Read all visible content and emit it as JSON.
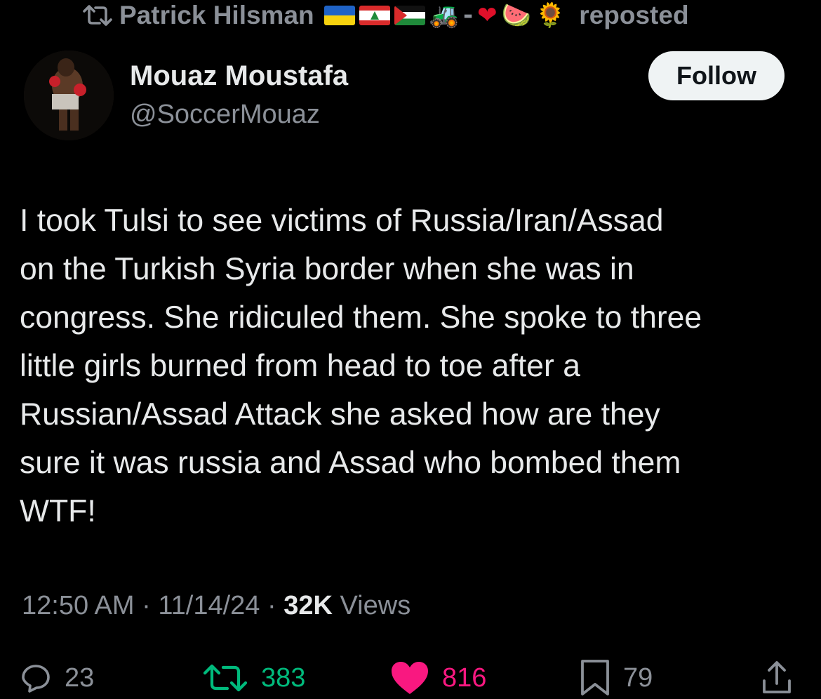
{
  "repost_header": {
    "reposter_name": "Patrick Hilsman",
    "emoji_flags": [
      "ukraine-flag",
      "lebanon-flag",
      "palestine-flag"
    ],
    "emoji_extra": {
      "tractor": "🚜",
      "dash": "-",
      "heart": "❤",
      "watermelon": "🍉",
      "sunflower": "🌻"
    },
    "label": "reposted"
  },
  "author": {
    "name": "Mouaz Moustafa",
    "handle": "@SoccerMouaz"
  },
  "follow_button": {
    "label": "Follow"
  },
  "tweet": {
    "lines": [
      "I took Tulsi to see victims of Russia/Iran/Assad",
      "on the Turkish Syria border when she was in",
      "congress. She ridiculed them. She spoke to three",
      "little girls burned from head to toe after a",
      "Russian/Assad Attack she asked how are they",
      "sure it was russia and Assad who bombed them",
      "WTF!"
    ]
  },
  "meta": {
    "time": "12:50 AM",
    "separator": " · ",
    "date": "11/14/24",
    "views_count": "32K",
    "views_label": " Views"
  },
  "actions": {
    "replies": "23",
    "reposts": "383",
    "likes": "816",
    "bookmarks": "79"
  },
  "colors": {
    "background": "#000000",
    "text": "#e7e9ea",
    "muted": "#8b9098",
    "repost_green": "#00ba7c",
    "like_pink": "#f91880",
    "follow_bg": "#eff3f4"
  }
}
